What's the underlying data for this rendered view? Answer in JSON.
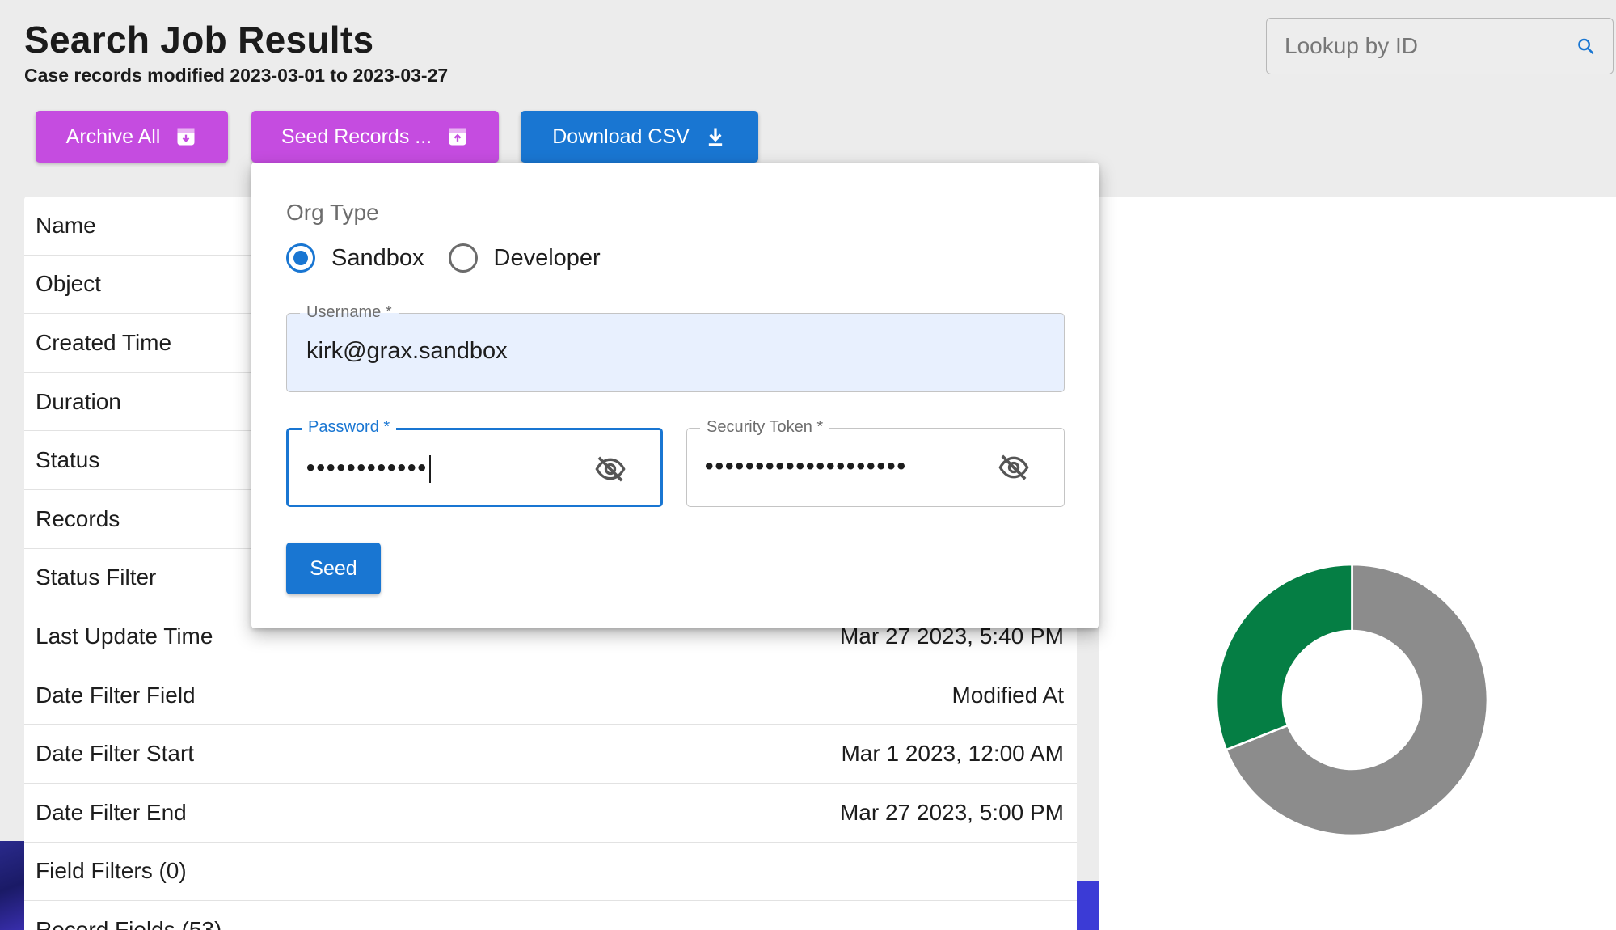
{
  "header": {
    "title": "Search Job Results",
    "subtitle": "Case records modified 2023-03-01 to 2023-03-27"
  },
  "lookup": {
    "placeholder": "Lookup by ID",
    "icon": "search-icon"
  },
  "toolbar": {
    "archive_label": "Archive All",
    "seed_label": "Seed Records ...",
    "download_label": "Download CSV"
  },
  "details": {
    "rows": [
      {
        "label": "Name",
        "value": ""
      },
      {
        "label": "Object",
        "value": ""
      },
      {
        "label": "Created Time",
        "value": ""
      },
      {
        "label": "Duration",
        "value": ""
      },
      {
        "label": "Status",
        "value": ""
      },
      {
        "label": "Records",
        "value": ""
      },
      {
        "label": "Status Filter",
        "value": ""
      },
      {
        "label": "Last Update Time",
        "value": "Mar 27 2023, 5:40 PM"
      },
      {
        "label": "Date Filter Field",
        "value": "Modified At"
      },
      {
        "label": "Date Filter Start",
        "value": "Mar 1 2023, 12:00 AM"
      },
      {
        "label": "Date Filter End",
        "value": "Mar 27 2023, 5:00 PM"
      },
      {
        "label": "Field Filters (0)",
        "value": ""
      },
      {
        "label": "Record Fields (53)",
        "value": ""
      }
    ]
  },
  "seed_dialog": {
    "org_type_label": "Org Type",
    "org_options": [
      "Sandbox",
      "Developer"
    ],
    "selected_org": "Sandbox",
    "username_label": "Username *",
    "username_value": "kirk@grax.sandbox",
    "password_label": "Password *",
    "password_mask": "••••••••••••",
    "token_label": "Security Token *",
    "token_mask": "••••••••••••••••••••",
    "submit_label": "Seed"
  },
  "chart_data": {
    "type": "pie",
    "donut": true,
    "slices": [
      {
        "value": 69,
        "color": "#8c8c8c"
      },
      {
        "value": 31,
        "color": "#057e44"
      }
    ]
  },
  "colors": {
    "purple_button": "#c54ce0",
    "blue_button": "#1976d2",
    "donut_gray": "#8c8c8c",
    "donut_green": "#057e44"
  }
}
